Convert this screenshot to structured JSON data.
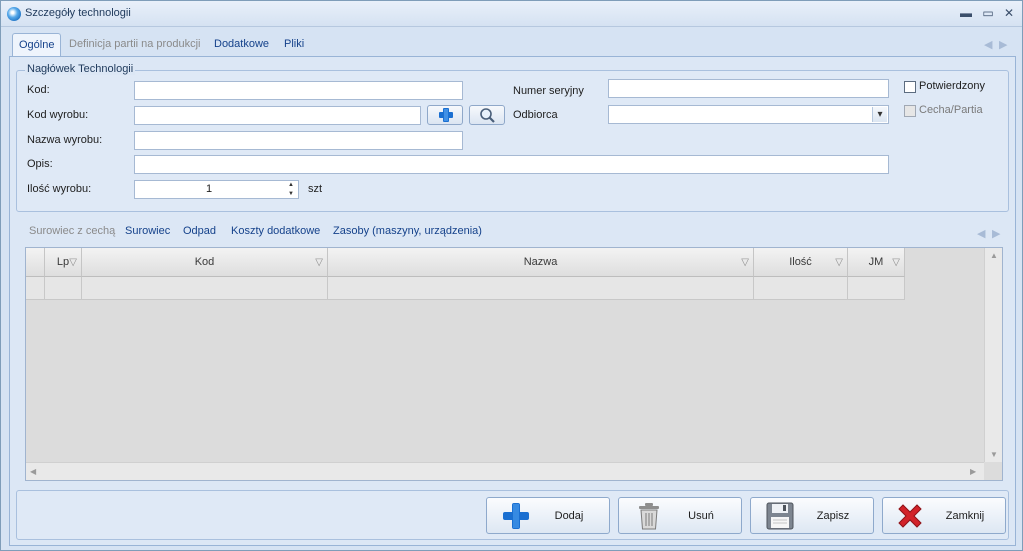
{
  "window": {
    "title": "Szczegóły technologii",
    "minimize": "▬",
    "maximize": "▭",
    "close": "✕"
  },
  "tabs": [
    {
      "label": "Ogólne"
    },
    {
      "label": "Definicja partii na produkcji"
    },
    {
      "label": "Dodatkowe"
    },
    {
      "label": "Pliki"
    }
  ],
  "nav": {
    "left": "◀",
    "right": "▶"
  },
  "header_group": {
    "title": "Nagłówek Technologii",
    "kod_label": "Kod:",
    "kod_value": "",
    "kod_wyrobu_label": "Kod wyrobu:",
    "kod_wyrobu_value": "",
    "nazwa_wyrobu_label": "Nazwa wyrobu:",
    "nazwa_wyrobu_value": "",
    "opis_label": "Opis:",
    "opis_value": "",
    "ilosc_label": "Ilość wyrobu:",
    "ilosc_value": "1",
    "ilosc_unit": "szt",
    "numer_seryjny_label": "Numer seryjny",
    "numer_seryjny_value": "",
    "odbiorca_label": "Odbiorca",
    "odbiorca_value": "",
    "potwierdzony_label": "Potwierdzony",
    "cecha_partia_label": "Cecha/Partia",
    "spin_up": "▲",
    "spin_down": "▼",
    "dropdown_arrow": "▾"
  },
  "subtabs": [
    {
      "label": "Surowiec z cechą"
    },
    {
      "label": "Surowiec"
    },
    {
      "label": "Odpad"
    },
    {
      "label": "Koszty dodatkowe"
    },
    {
      "label": "Zasoby (maszyny, urządzenia)"
    }
  ],
  "grid": {
    "columns": [
      {
        "label": ""
      },
      {
        "label": "Lp"
      },
      {
        "label": "Kod"
      },
      {
        "label": "Nazwa"
      },
      {
        "label": "Ilość"
      },
      {
        "label": "JM"
      }
    ],
    "filter_glyph": "▽",
    "scroll_up": "▲",
    "scroll_down": "▼",
    "scroll_left": "◀",
    "scroll_right": "▶"
  },
  "actions": {
    "add": "Dodaj",
    "delete": "Usuń",
    "save": "Zapisz",
    "close": "Zamknij"
  },
  "icons": {
    "app": "gear-flower-icon",
    "add_plus": "plus-icon",
    "search": "magnifier-icon",
    "trash": "trash-icon",
    "floppy": "floppy-icon",
    "red_x": "red-x-icon"
  },
  "colors": {
    "accent": "#15428b",
    "plus_blue": "#1a6fd1",
    "close_red": "#d2232a"
  }
}
